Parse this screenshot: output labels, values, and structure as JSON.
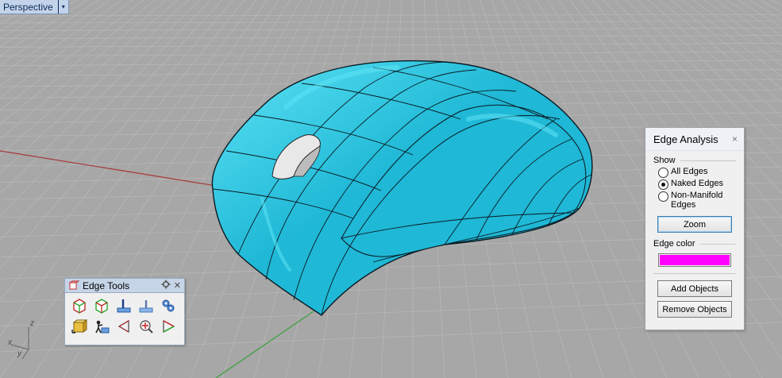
{
  "viewport": {
    "title": "Perspective",
    "dropdown_glyph": "▾",
    "background_color": "#a7a7a7",
    "grid_color": "#b9b9b9",
    "x_axis_color": "#a83838",
    "y_axis_color": "#3d9e3d",
    "model_color": "#1fb8d6",
    "model_highlight": "#5de3f5",
    "model_edge_color": "#0a1a22"
  },
  "axis_widget": {
    "z": "z",
    "x": "x",
    "y": "y"
  },
  "edge_tools": {
    "title": "Edge Tools",
    "settings_icon": "gear-icon",
    "close_glyph": "✕",
    "tools": [
      {
        "name": "split-edge-icon"
      },
      {
        "name": "merge-edge-icon"
      },
      {
        "name": "split-face-edge-icon"
      },
      {
        "name": "merge-all-edges-icon"
      },
      {
        "name": "rebuild-edges-icon"
      },
      {
        "name": "show-edges-icon"
      },
      {
        "name": "join-2-naked-edges-icon"
      },
      {
        "name": "select-naked-edges-icon"
      },
      {
        "name": "extract-edges-icon"
      },
      {
        "name": "duplicate-border-icon"
      }
    ]
  },
  "edge_analysis": {
    "title": "Edge Analysis",
    "close_glyph": "×",
    "show_label": "Show",
    "options": [
      {
        "label": "All Edges",
        "selected": false
      },
      {
        "label": "Naked Edges",
        "selected": true
      },
      {
        "label": "Non-Manifold Edges",
        "selected": false
      }
    ],
    "zoom_label": "Zoom",
    "edge_color_label": "Edge color",
    "edge_color": "#ff00ff",
    "add_objects_label": "Add Objects",
    "remove_objects_label": "Remove Objects"
  }
}
